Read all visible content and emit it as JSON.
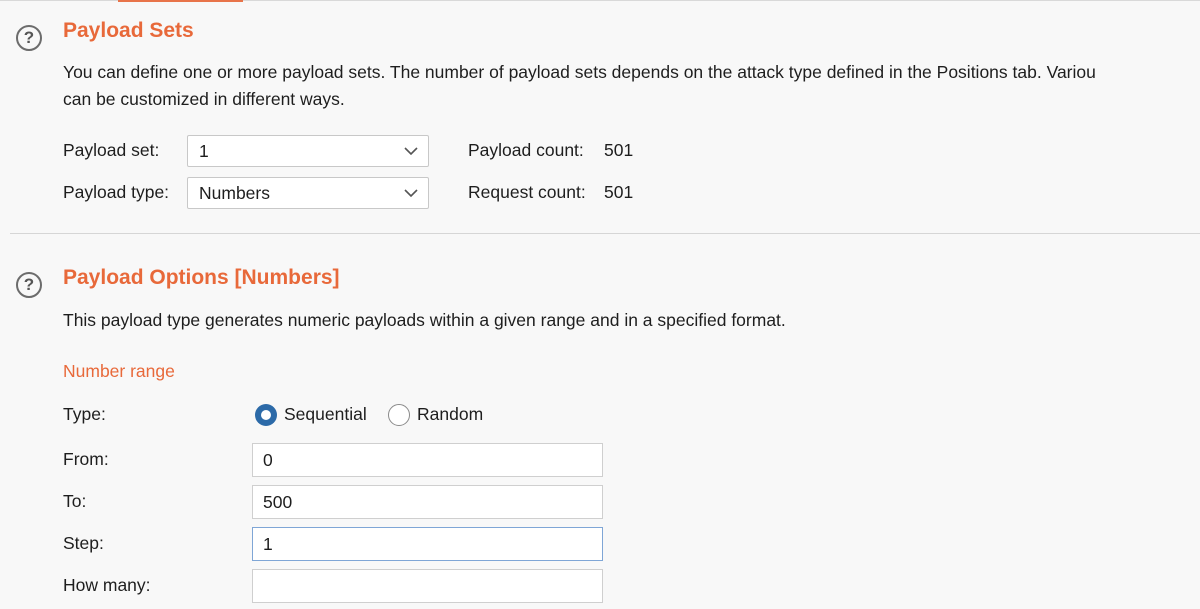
{
  "payload_sets": {
    "title": "Payload Sets",
    "description_line1": "You can define one or more payload sets. The number of payload sets depends on the attack type defined in the Positions tab. Variou",
    "description_line2": "can be customized in different ways.",
    "payload_set_label": "Payload set:",
    "payload_set_value": "1",
    "payload_type_label": "Payload type:",
    "payload_type_value": "Numbers",
    "payload_count_label": "Payload count:",
    "payload_count_value": "501",
    "request_count_label": "Request count:",
    "request_count_value": "501"
  },
  "payload_options": {
    "title": "Payload Options [Numbers]",
    "description": "This payload type generates numeric payloads within a given range and in a specified format.",
    "number_range_heading": "Number range",
    "type_label": "Type:",
    "type_options": [
      "Sequential",
      "Random"
    ],
    "type_selected": "Sequential",
    "from_label": "From:",
    "from_value": "0",
    "to_label": "To:",
    "to_value": "500",
    "step_label": "Step:",
    "step_value": "1",
    "how_many_label": "How many:",
    "how_many_value": ""
  },
  "icons": {
    "help": "?"
  },
  "colors": {
    "accent": "#e8693a",
    "radio_selected": "#2c6aa8",
    "focus_border": "#7fa6d6"
  }
}
